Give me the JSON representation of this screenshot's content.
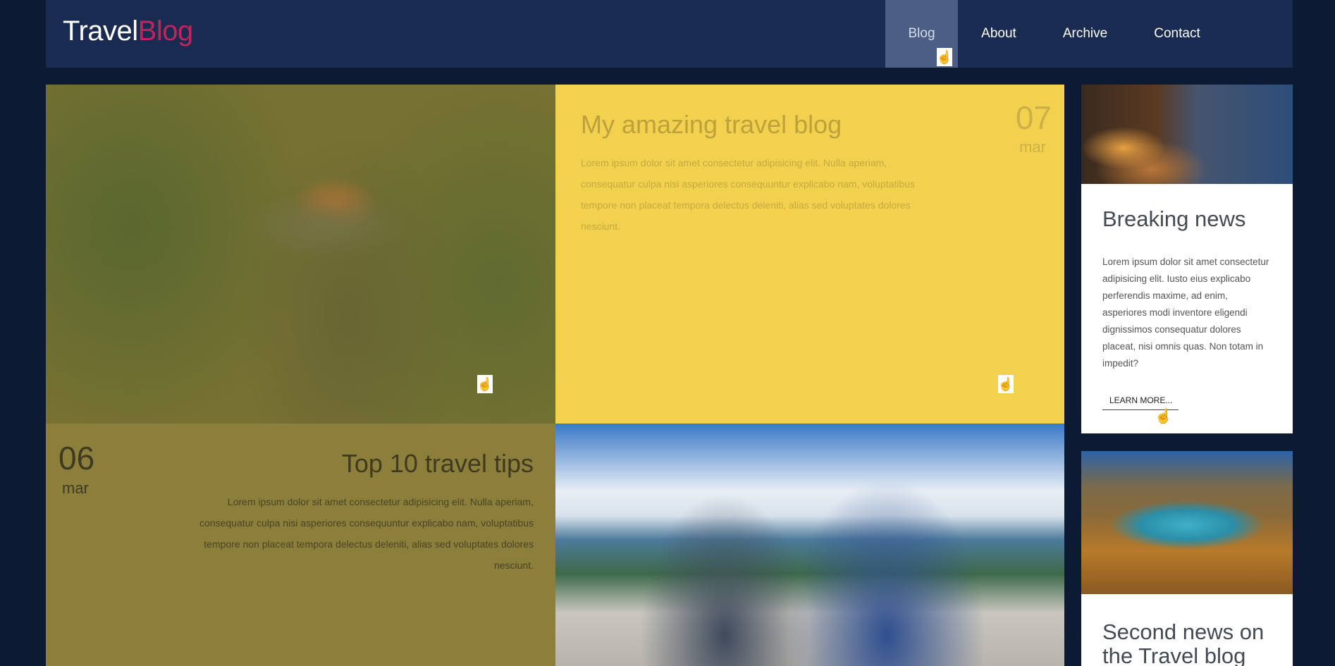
{
  "logo": {
    "part1": "Travel",
    "part2": "Blog"
  },
  "nav": {
    "items": [
      {
        "label": "Blog",
        "active": true
      },
      {
        "label": "About",
        "active": false
      },
      {
        "label": "Archive",
        "active": false
      },
      {
        "label": "Contact",
        "active": false
      }
    ]
  },
  "posts": {
    "post1": {
      "title": "My amazing travel blog",
      "body": "Lorem ipsum dolor sit amet consectetur adipisicing elit. Nulla aperiam, consequatur culpa nisi asperiores consequuntur explicabo nam, voluptatibus tempore non placeat tempora delectus deleniti, alias sed voluptates dolores nesciunt.",
      "day": "07",
      "month": "mar"
    },
    "post2": {
      "title": "Top 10 travel tips",
      "body": "Lorem ipsum dolor sit amet consectetur adipisicing elit. Nulla aperiam, consequatur culpa nisi asperiores consequuntur explicabo nam, voluptatibus tempore non placeat tempora delectus deleniti, alias sed voluptates dolores nesciunt.",
      "day": "06",
      "month": "mar"
    }
  },
  "sidebar": {
    "card1": {
      "title": "Breaking news",
      "text": "Lorem ipsum dolor sit amet consectetur adipisicing elit. Iusto eius explicabo perferendis maxime, ad enim, asperiores modi inventore eligendi dignissimos consequatur dolores placeat, nisi omnis quas. Non totam in impedit?",
      "link": "LEARN MORE..."
    },
    "card2": {
      "title": "Second news on the Travel blog"
    }
  },
  "colors": {
    "background": "#0c1a33",
    "header": "#1a2b52",
    "nav_active": "#4b5e84",
    "logo_accent": "#c0245c",
    "yellow_tile": "#f2d14f",
    "olive_tile": "#8c7f3b"
  }
}
